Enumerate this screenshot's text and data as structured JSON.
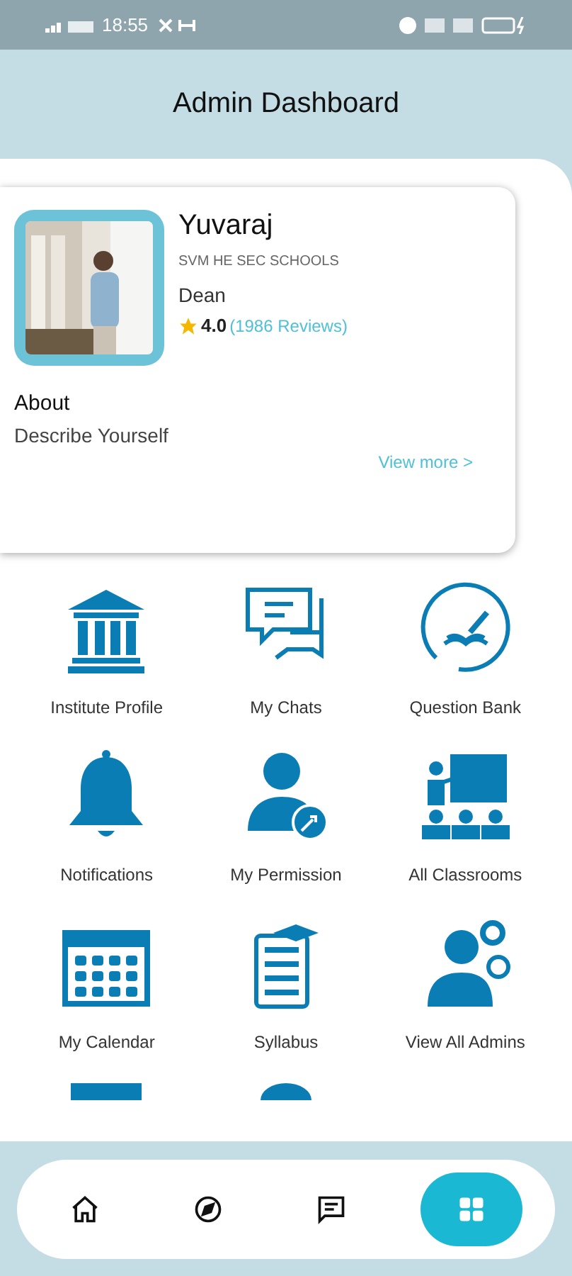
{
  "status_bar": {
    "time": "18:55"
  },
  "header": {
    "title": "Admin Dashboard"
  },
  "profile": {
    "name": "Yuvaraj",
    "school": "SVM HE SEC SCHOOLS",
    "role": "Dean",
    "rating": "4.0",
    "reviews": "(1986 Reviews)",
    "about_title": "About",
    "about_text": "Describe Yourself",
    "link": "View more >"
  },
  "tiles": [
    {
      "label": "Institute Profile"
    },
    {
      "label": "My Chats"
    },
    {
      "label": "Question Bank"
    },
    {
      "label": "Notifications"
    },
    {
      "label": "My Permission"
    },
    {
      "label": "All Classrooms"
    },
    {
      "label": "My Calendar"
    },
    {
      "label": "Syllabus"
    },
    {
      "label": "View All Admins"
    }
  ],
  "nav": [
    {
      "selected": false
    },
    {
      "selected": false
    },
    {
      "selected": false
    },
    {
      "selected": true
    }
  ]
}
